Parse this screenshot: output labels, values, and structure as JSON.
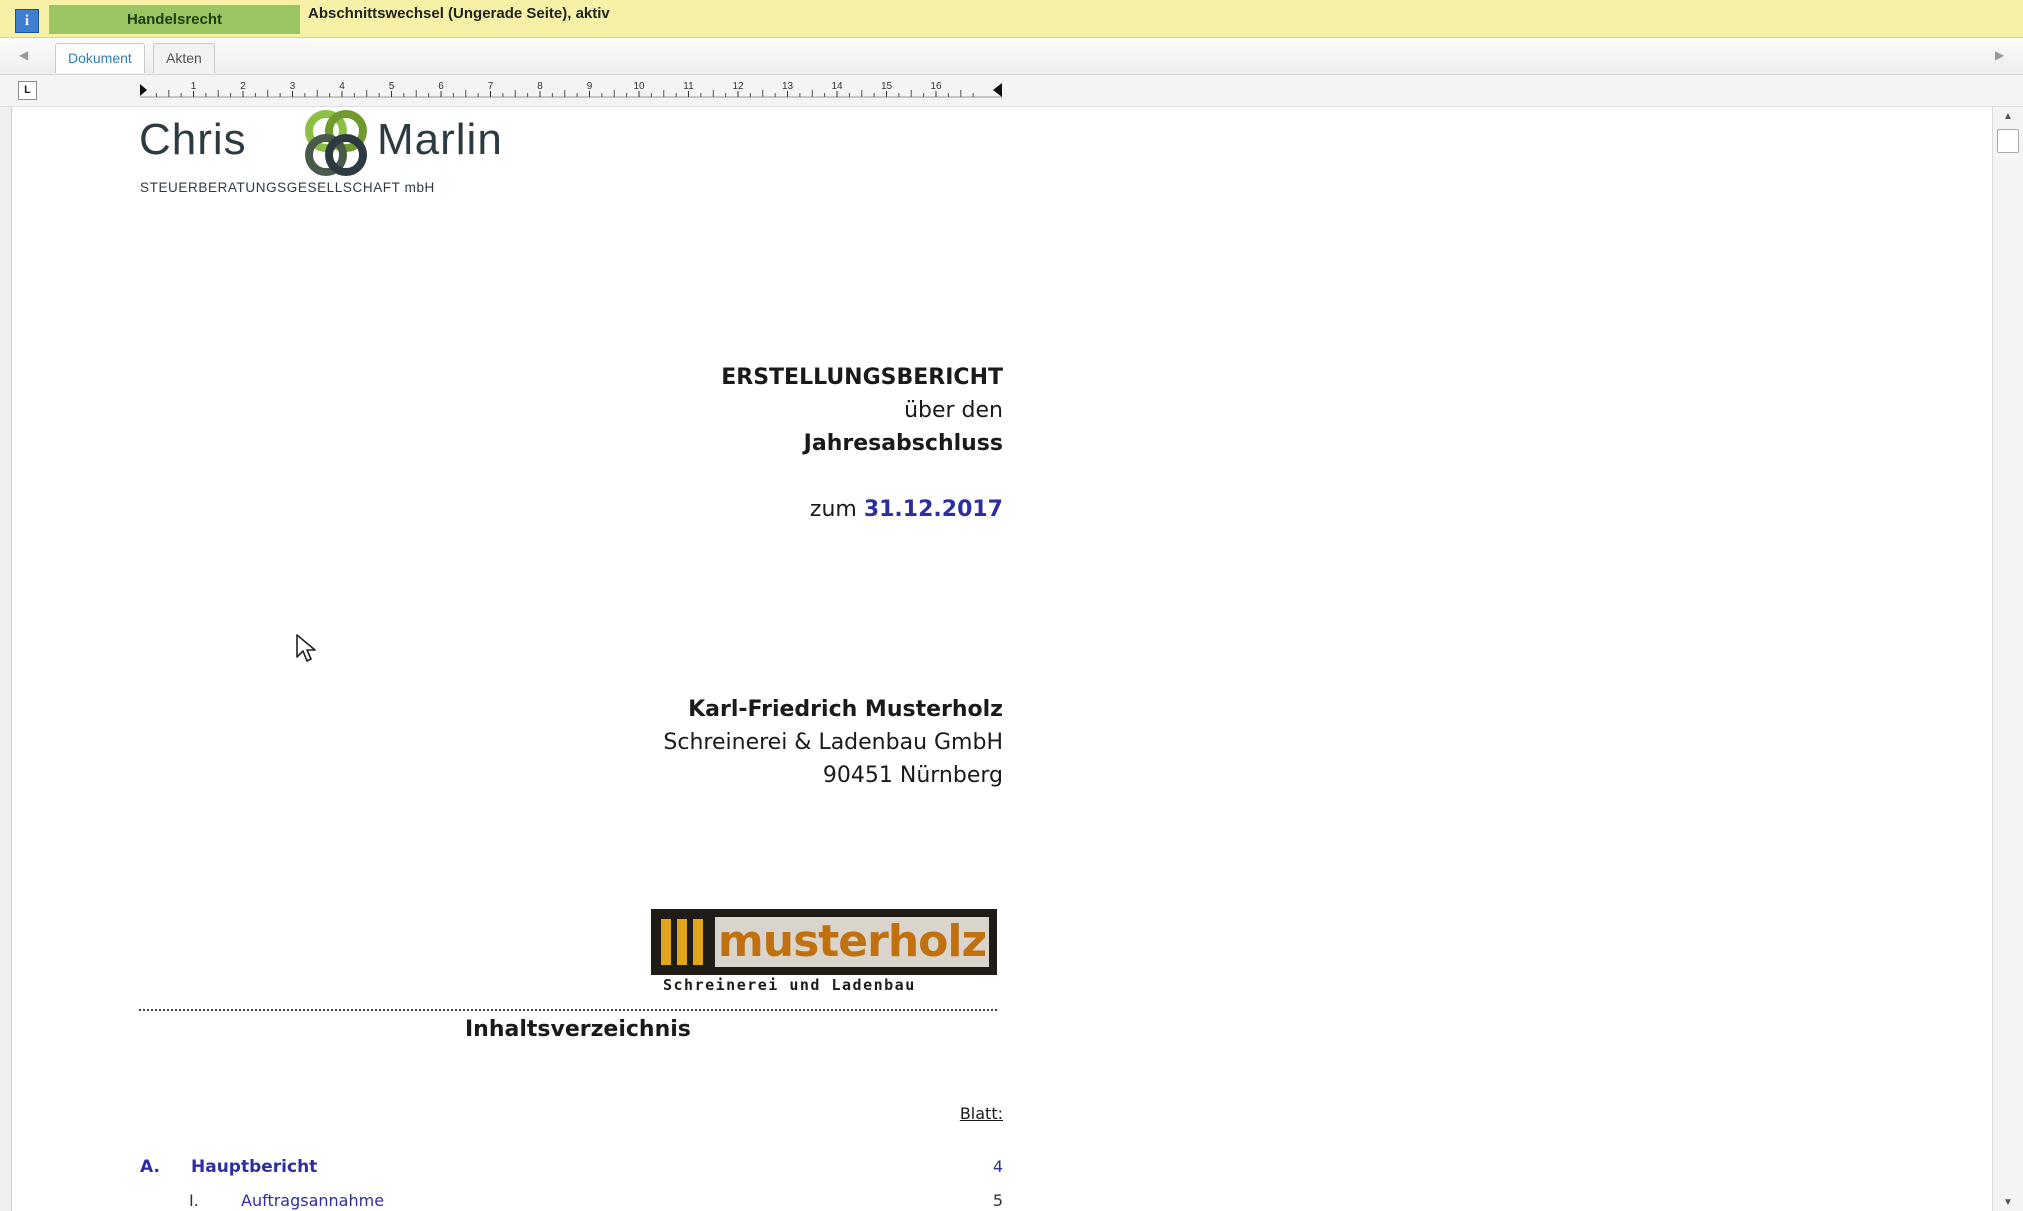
{
  "statusbar": {
    "info_icon": "i",
    "section_label": "Handelsrecht",
    "section_status": "Abschnittswechsel (Ungerade Seite), aktiv"
  },
  "tabs": [
    {
      "label": "Dokument",
      "active": true
    },
    {
      "label": "Akten",
      "active": false
    }
  ],
  "ruler": {
    "tab_stop_symbol": "L",
    "numbers": [
      "1",
      "2",
      "3",
      "4",
      "5",
      "6",
      "7",
      "8",
      "9",
      "10",
      "11",
      "12",
      "13",
      "14",
      "15",
      "16"
    ]
  },
  "document": {
    "logo": {
      "name_left": "Chris",
      "name_right": "Marlin",
      "tagline": "STEUERBERATUNGSGESELLSCHAFT mbH"
    },
    "title": {
      "line1": "ERSTELLUNGSBERICHT",
      "line2": "über den",
      "line3": "Jahresabschluss",
      "date_prefix": "zum",
      "date": "31.12.2017"
    },
    "client": {
      "name": "Karl-Friedrich Musterholz",
      "company": "Schreinerei & Ladenbau GmbH",
      "city": "90451 Nürnberg"
    },
    "client_logo": {
      "word": "musterholz",
      "subtitle": "Schreinerei und Ladenbau"
    },
    "toc": {
      "heading": "Inhaltsverzeichnis",
      "page_col_label": "Blatt:",
      "entries": [
        {
          "num": "A.",
          "label": "Hauptbericht",
          "page": "4"
        },
        {
          "num": "I.",
          "label": "Auftragsannahme",
          "page": "5"
        }
      ]
    }
  },
  "colors": {
    "status_bg": "#f6f1a6",
    "section_green": "#9bc560",
    "accent_blue": "#2e2ea0",
    "active_tab": "#2a7fc0"
  }
}
